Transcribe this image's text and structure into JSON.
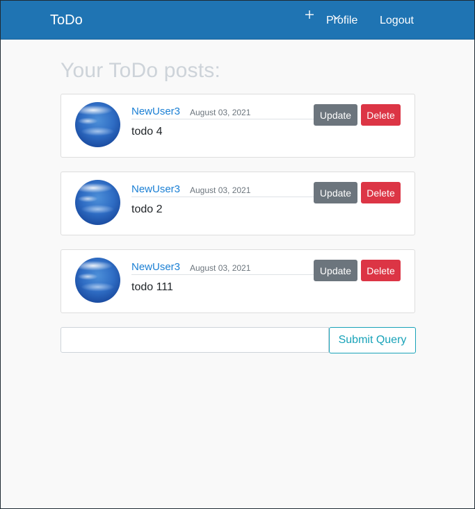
{
  "navbar": {
    "brand": "ToDo",
    "add_icon": "plus-icon",
    "menu_icon": "chevron-down-icon",
    "profile_label": "Profile",
    "logout_label": "Logout",
    "background_color": "#1f74b3"
  },
  "main": {
    "title": "Your ToDo posts:",
    "posts": [
      {
        "author": "NewUser3",
        "date": "August 03, 2021",
        "content": "todo 4",
        "update_label": "Update",
        "delete_label": "Delete"
      },
      {
        "author": "NewUser3",
        "date": "August 03, 2021",
        "content": "todo 2",
        "update_label": "Update",
        "delete_label": "Delete"
      },
      {
        "author": "NewUser3",
        "date": "August 03, 2021",
        "content": "todo 111",
        "update_label": "Update",
        "delete_label": "Delete"
      }
    ]
  },
  "form": {
    "input_value": "",
    "submit_label": "Submit Query"
  },
  "colors": {
    "link": "#1a7fd4",
    "update_button": "#6c757d",
    "delete_button": "#dc3545",
    "submit_outline": "#17a2b8"
  }
}
